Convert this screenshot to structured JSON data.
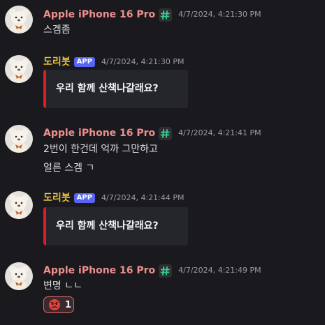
{
  "colors": {
    "background": "#1a1a1e",
    "apple_name": "#ee8e8e",
    "bot_name": "#e6bf3c",
    "app_badge": "#5865f2",
    "embed_bar": "#e01b24",
    "hash_icon": "#3ecf8e",
    "reaction_border": "#d96a6a"
  },
  "users": {
    "apple": {
      "name": "Apple iPhone 16 Pro",
      "badge_icon": "hash-icon"
    },
    "bot": {
      "name": "도리봇",
      "badge": "APP"
    }
  },
  "messages": [
    {
      "timestamp": "4/7/2024, 4:21:30 PM",
      "lines": [
        "스겜좀"
      ]
    },
    {
      "timestamp": "4/7/2024, 4:21:30 PM",
      "embed_title": "우리 함께 산책나갈래요?"
    },
    {
      "timestamp": "4/7/2024, 4:21:41 PM",
      "lines": [
        "2번이 한건데 억까 그만하고",
        "얼른 스겜 ㄱ"
      ]
    },
    {
      "timestamp": "4/7/2024, 4:21:44 PM",
      "embed_title": "우리 함께 산책나갈래요?"
    },
    {
      "timestamp": "4/7/2024, 4:21:49 PM",
      "lines": [
        "변명 ㄴㄴ"
      ],
      "reaction": {
        "icon": "angry-face-icon",
        "count": "1"
      }
    }
  ]
}
